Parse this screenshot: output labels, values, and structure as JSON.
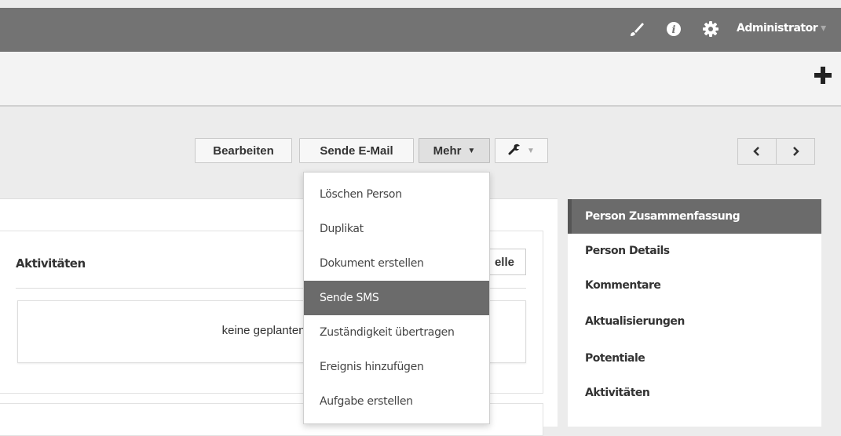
{
  "topbar": {
    "icons": [
      "brush-icon",
      "info-icon",
      "gear-icon"
    ],
    "user_label": "Administrator",
    "user_caret": "▾"
  },
  "subbar": {
    "add_icon": "plus-icon"
  },
  "toolbar": {
    "edit_label": "Bearbeiten",
    "email_label": "Sende E-Mail",
    "more_label": "Mehr",
    "more_caret": "▼",
    "tools_icon": "wrench-icon",
    "tools_caret": "▼"
  },
  "pager": {
    "prev_icon": "chevron-left-icon",
    "next_icon": "chevron-right-icon"
  },
  "dropdown": {
    "items": [
      {
        "label": "Löschen Person"
      },
      {
        "label": "Duplikat"
      },
      {
        "label": "Dokument erstellen"
      },
      {
        "label": "Sende SMS",
        "highlighted": true
      },
      {
        "label": "Zuständigkeit übertragen"
      },
      {
        "label": "Ereignis hinzufügen"
      },
      {
        "label": "Aufgabe erstellen"
      }
    ]
  },
  "activities_panel": {
    "title": "Aktivitäten",
    "button_label_visible": "elle",
    "empty_text": "keine geplanten Ak"
  },
  "right_nav": {
    "items": [
      {
        "label": "Person Zusammenfassung",
        "active": true
      },
      {
        "label": "Person Details"
      },
      {
        "label": "Kommentare"
      },
      {
        "label": "Aktualisierungen"
      },
      {
        "label": "Potentiale"
      },
      {
        "label": "Aktivitäten"
      }
    ]
  },
  "colors": {
    "topbar_bg": "#737373",
    "highlight_bg": "#6b6b6b",
    "page_bg": "#ececec"
  }
}
